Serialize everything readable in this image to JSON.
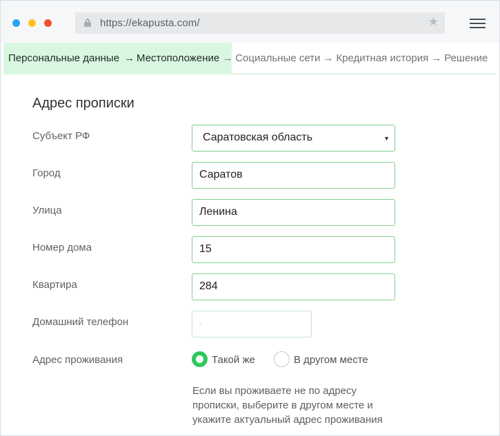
{
  "browser": {
    "url": "https://ekapusta.com/"
  },
  "steps": [
    {
      "label": "Персональные данные",
      "state": "done"
    },
    {
      "label": "Местоположение",
      "state": "done"
    },
    {
      "label": "Социальные сети",
      "state": "todo"
    },
    {
      "label": "Кредитная история",
      "state": "todo"
    },
    {
      "label": "Решение",
      "state": "todo"
    }
  ],
  "arrow": "→",
  "form": {
    "title": "Адрес прописки",
    "region": {
      "label": "Субъект РФ",
      "value": "Саратовская область"
    },
    "city": {
      "label": "Город",
      "value": "Саратов"
    },
    "street": {
      "label": "Улица",
      "value": "Ленина"
    },
    "house": {
      "label": "Номер дома",
      "value": "15"
    },
    "apartment": {
      "label": "Квартира",
      "value": "284"
    },
    "home_phone": {
      "label": "Домашний телефон",
      "value": "-"
    },
    "residence": {
      "label": "Адрес проживания",
      "options": [
        "Такой же",
        "В другом месте"
      ],
      "selected": "Такой же"
    },
    "hint": "Если вы проживаете не по адресу прописки, выберите в другом месте и укажите актуальный адрес проживания"
  },
  "colors": {
    "accent_green": "#2dc85b",
    "active_step_bg": "#d9f7e0",
    "field_border": "#7fd08d"
  },
  "icons": {
    "lock": "lock-icon",
    "star": "star-icon",
    "menu": "hamburger-menu-icon",
    "caret": "chevron-down-icon"
  }
}
